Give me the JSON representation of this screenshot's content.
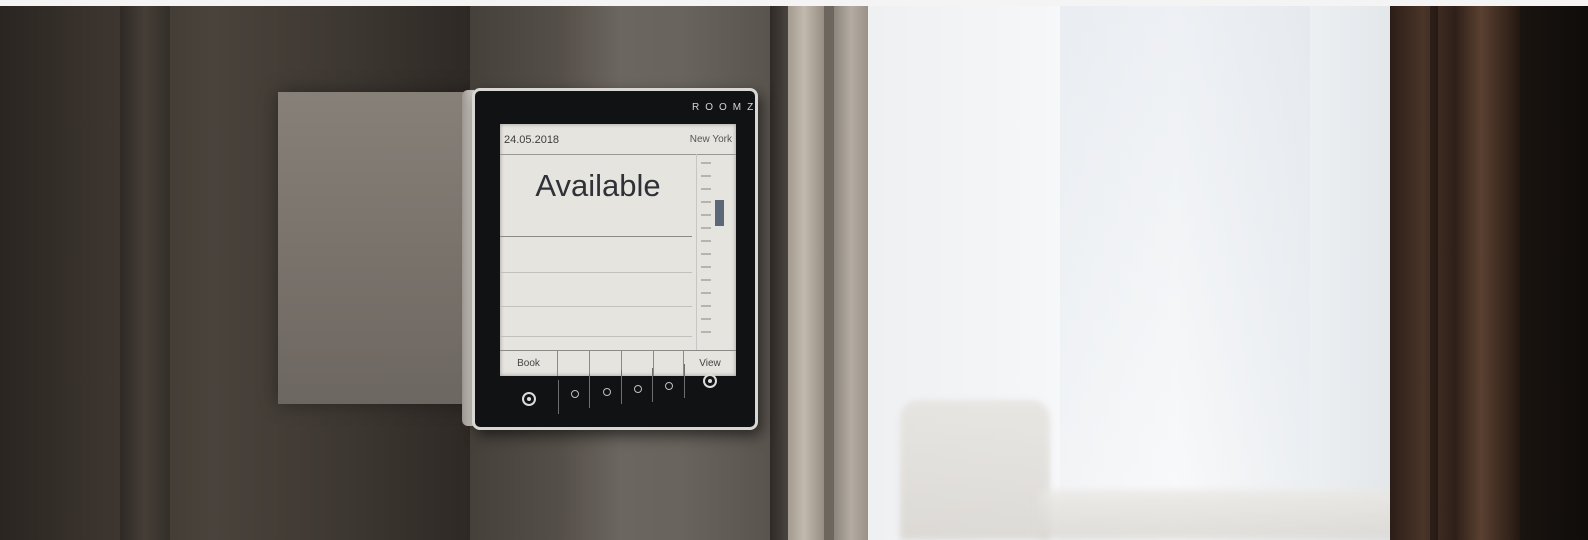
{
  "device": {
    "brand": "ROOMZ",
    "date": "24.05.2018",
    "location": "New York",
    "status": "Available",
    "buttons": {
      "left_label": "Book",
      "right_label": "View"
    },
    "timeline": {
      "booked_slot_color": "#5c6878"
    }
  },
  "scene": {
    "icons": [
      "select-button-icon",
      "option-button-icon"
    ]
  }
}
